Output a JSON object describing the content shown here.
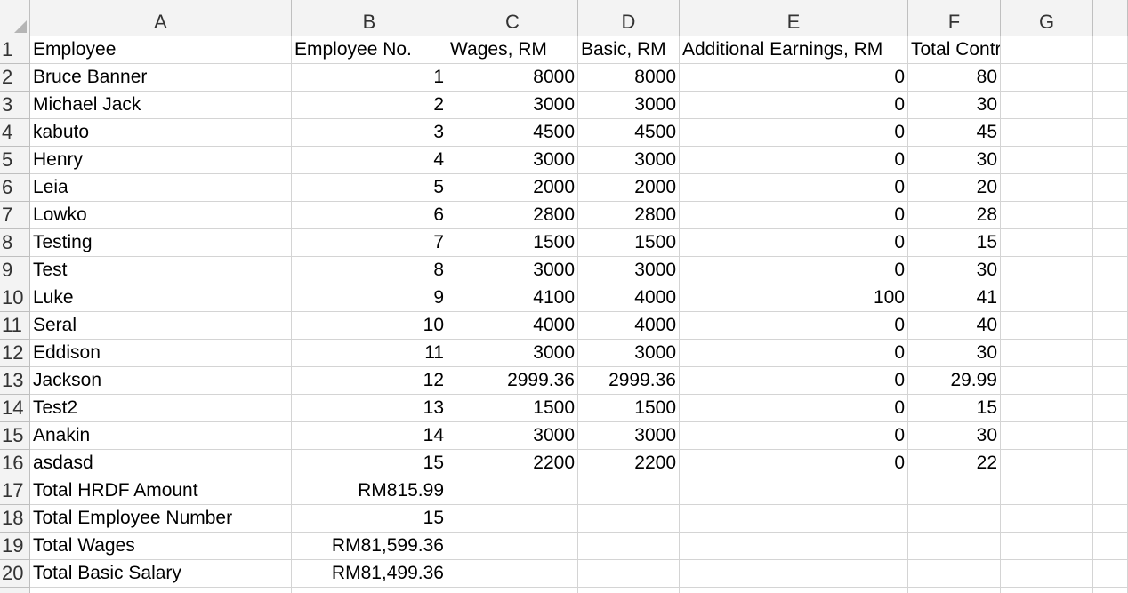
{
  "sheet": {
    "column_letters": [
      "A",
      "B",
      "C",
      "D",
      "E",
      "F",
      "G"
    ],
    "row_numbers": [
      "1",
      "2",
      "3",
      "4",
      "5",
      "6",
      "7",
      "8",
      "9",
      "10",
      "11",
      "12",
      "13",
      "14",
      "15",
      "16",
      "17",
      "18",
      "19",
      "20"
    ],
    "rows": [
      [
        "Employee",
        "Employee No.",
        "Wages, RM",
        "Basic, RM",
        "Additional Earnings, RM",
        "Total Contribution, RM",
        ""
      ],
      [
        "Bruce Banner",
        "1",
        "8000",
        "8000",
        "0",
        "80",
        ""
      ],
      [
        "Michael Jack",
        "2",
        "3000",
        "3000",
        "0",
        "30",
        ""
      ],
      [
        "kabuto",
        "3",
        "4500",
        "4500",
        "0",
        "45",
        ""
      ],
      [
        "Henry",
        "4",
        "3000",
        "3000",
        "0",
        "30",
        ""
      ],
      [
        "Leia",
        "5",
        "2000",
        "2000",
        "0",
        "20",
        ""
      ],
      [
        "Lowko",
        "6",
        "2800",
        "2800",
        "0",
        "28",
        ""
      ],
      [
        "Testing",
        "7",
        "1500",
        "1500",
        "0",
        "15",
        ""
      ],
      [
        "Test",
        "8",
        "3000",
        "3000",
        "0",
        "30",
        ""
      ],
      [
        "Luke",
        "9",
        "4100",
        "4000",
        "100",
        "41",
        ""
      ],
      [
        "Seral",
        "10",
        "4000",
        "4000",
        "0",
        "40",
        ""
      ],
      [
        "Eddison",
        "11",
        "3000",
        "3000",
        "0",
        "30",
        ""
      ],
      [
        "Jackson",
        "12",
        "2999.36",
        "2999.36",
        "0",
        "29.99",
        ""
      ],
      [
        "Test2",
        "13",
        "1500",
        "1500",
        "0",
        "15",
        ""
      ],
      [
        "Anakin",
        "14",
        "3000",
        "3000",
        "0",
        "30",
        ""
      ],
      [
        "asdasd",
        "15",
        "2200",
        "2200",
        "0",
        "22",
        ""
      ],
      [
        "Total HRDF Amount",
        "RM815.99",
        "",
        "",
        "",
        "",
        ""
      ],
      [
        "Total Employee Number",
        "15",
        "",
        "",
        "",
        "",
        ""
      ],
      [
        "Total Wages",
        "RM81,599.36",
        "",
        "",
        "",
        "",
        ""
      ],
      [
        "Total Basic Salary",
        "RM81,499.36",
        "",
        "",
        "",
        "",
        ""
      ]
    ],
    "colors": {
      "header_bg": "#f3f3f3",
      "gridline": "#d4d4d4",
      "header_border": "#bfbfbf"
    }
  }
}
